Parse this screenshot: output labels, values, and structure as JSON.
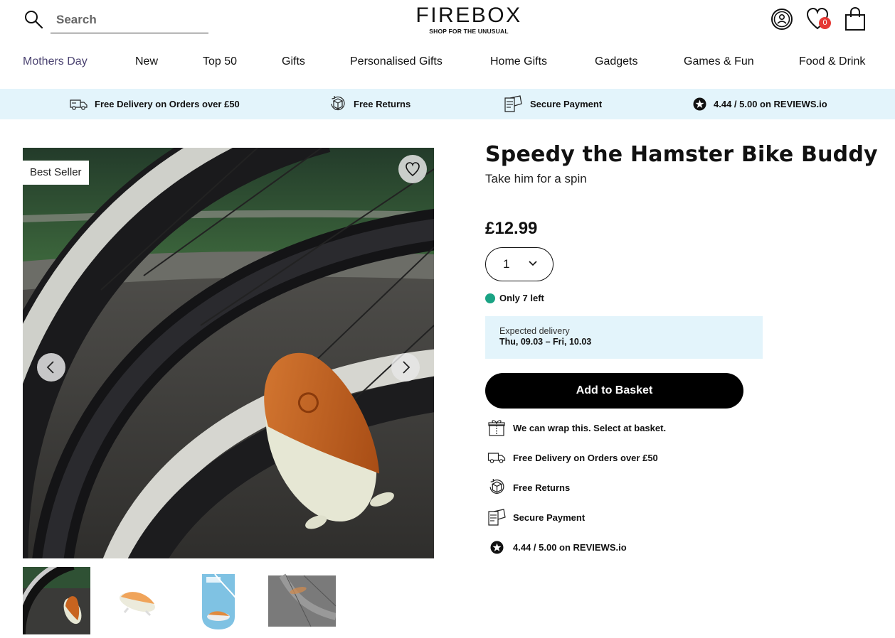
{
  "header": {
    "search_placeholder": "Search",
    "logo_text": "FIREBOX",
    "logo_tagline": "SHOP FOR THE UNUSUAL",
    "wishlist_count": "0"
  },
  "nav": {
    "items": [
      {
        "label": "Mothers Day"
      },
      {
        "label": "New"
      },
      {
        "label": "Top 50"
      },
      {
        "label": "Gifts"
      },
      {
        "label": "Personalised Gifts"
      },
      {
        "label": "Home Gifts"
      },
      {
        "label": "Gadgets"
      },
      {
        "label": "Games & Fun"
      },
      {
        "label": "Food & Drink"
      }
    ]
  },
  "usp_bar": {
    "items": [
      {
        "label": "Free Delivery on Orders over £50",
        "icon": "truck-icon"
      },
      {
        "label": "Free Returns",
        "icon": "returns-box-icon"
      },
      {
        "label": "Secure Payment",
        "icon": "payment-card-icon"
      },
      {
        "label": "4.44 / 5.00 on REVIEWS.io",
        "icon": "star-badge-icon"
      }
    ]
  },
  "gallery": {
    "badge": "Best Seller",
    "thumbnail_count": 4
  },
  "product": {
    "title": "Speedy the Hamster Bike Buddy",
    "subtitle": "Take him for a spin",
    "price": "£12.99",
    "quantity": "1",
    "stock": "Only 7 left",
    "delivery_label": "Expected delivery",
    "delivery_dates": "Thu, 09.03 – Fri, 10.03",
    "add_to_basket": "Add to Basket",
    "perks": [
      {
        "label": "We can wrap this. Select at basket.",
        "icon": "gift-icon"
      },
      {
        "label": "Free Delivery on Orders over £50",
        "icon": "truck-icon"
      },
      {
        "label": "Free Returns",
        "icon": "returns-box-icon"
      },
      {
        "label": "Secure Payment",
        "icon": "payment-card-icon"
      },
      {
        "label": "4.44 / 5.00 on REVIEWS.io",
        "icon": "star-badge-icon"
      }
    ]
  },
  "colors": {
    "usp_background": "#e3f4fb",
    "active_nav": "#4b4371",
    "stock_dot": "#1aa384",
    "badge_red": "#e53935",
    "button_black": "#000000"
  }
}
